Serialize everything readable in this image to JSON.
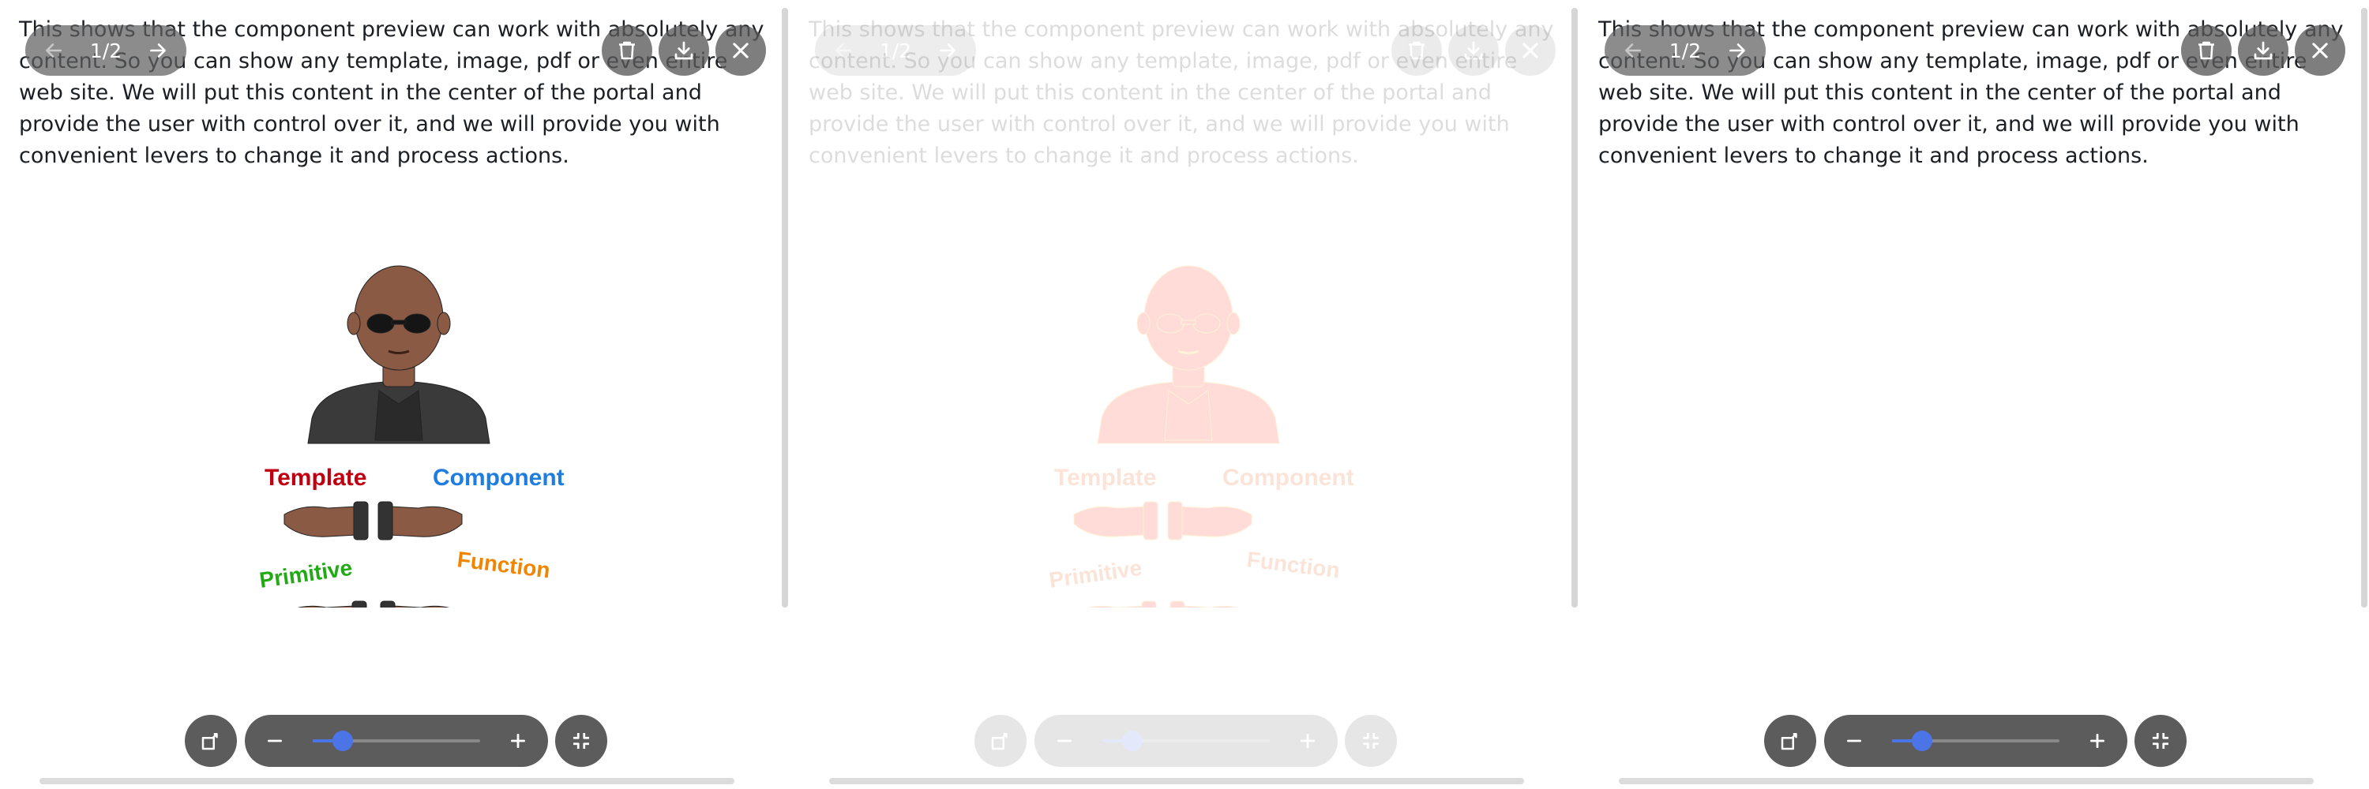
{
  "description": "This shows that the component preview can work with absolutely any content. So you can show any template, image, pdf or even entire web site. We will put this content in the center of the portal and provide the user with control over it, and we will provide you with convenient levers to change it and process actions.",
  "pagination": {
    "label": "1/2"
  },
  "illustration": {
    "labels": {
      "template": "Template",
      "component": "Component",
      "primitive": "Primitive",
      "function": "Function"
    },
    "colors": {
      "template": "#c00010",
      "component": "#1f7de0",
      "primitive": "#22aa15",
      "function": "#f08500",
      "filtered_fill": "#ff1a00",
      "filtered_label": "#e64a00",
      "skin": "#8a5a44",
      "shirt": "#3a3a3a"
    }
  },
  "zoom": {
    "value": 0.18
  },
  "icons": {
    "prev": "arrow-left-icon",
    "next": "arrow-right-icon",
    "delete": "trash-icon",
    "download": "download-icon",
    "close": "close-icon",
    "rotate": "rotate-icon",
    "zoom_out": "minus-icon",
    "zoom_in": "plus-icon",
    "fullscreen": "collapse-icon"
  },
  "accent": "#4b74e6"
}
